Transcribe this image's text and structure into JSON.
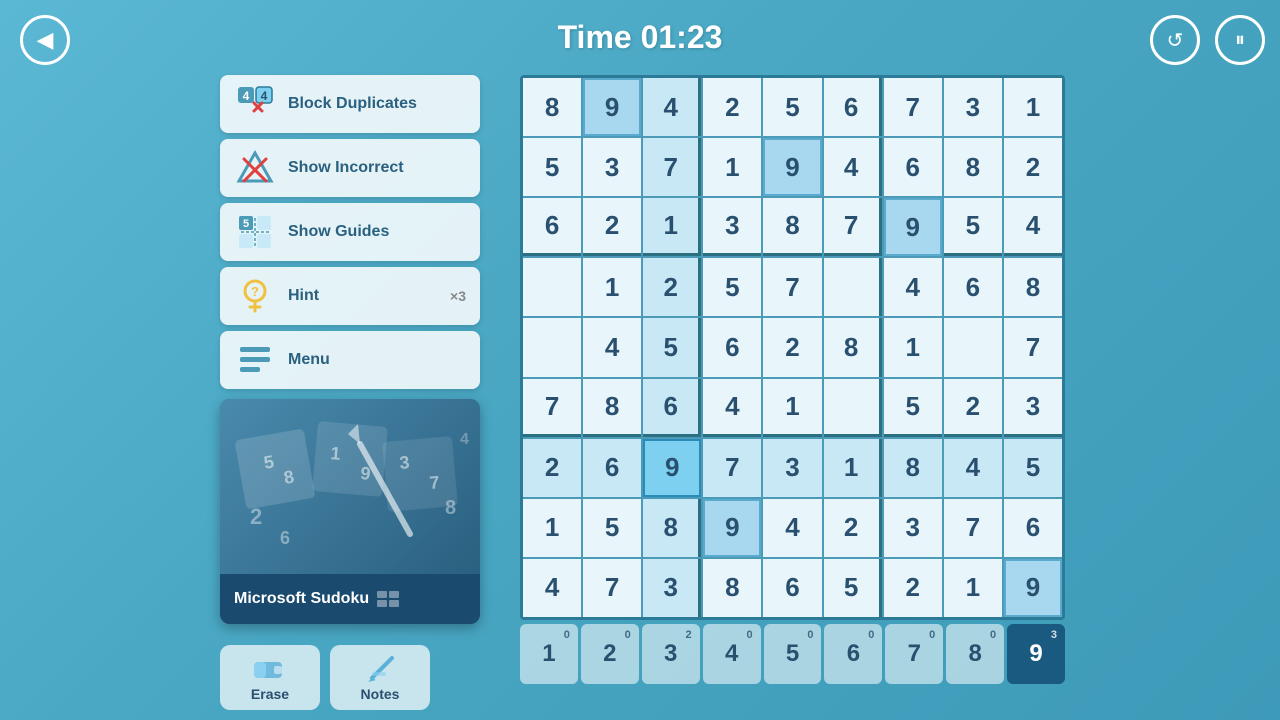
{
  "header": {
    "timer_label": "Time 01:23",
    "back_label": "◀",
    "undo_label": "↺",
    "pause_label": "⏸"
  },
  "menu": {
    "block_duplicates_label": "Block Duplicates",
    "show_incorrect_label": "Show Incorrect",
    "show_guides_label": "Show Guides",
    "hint_label": "Hint",
    "hint_count": "×3",
    "menu_label": "Menu"
  },
  "preview": {
    "title": "Microsoft Sudoku"
  },
  "grid": {
    "cells": [
      [
        8,
        9,
        4,
        2,
        5,
        6,
        7,
        3,
        1
      ],
      [
        5,
        3,
        7,
        1,
        9,
        4,
        6,
        8,
        2
      ],
      [
        6,
        2,
        1,
        3,
        8,
        7,
        9,
        5,
        4
      ],
      [
        0,
        1,
        2,
        5,
        7,
        0,
        4,
        6,
        8
      ],
      [
        0,
        4,
        5,
        6,
        2,
        8,
        1,
        0,
        7
      ],
      [
        7,
        8,
        6,
        4,
        1,
        0,
        5,
        2,
        3
      ],
      [
        2,
        6,
        9,
        7,
        3,
        1,
        8,
        4,
        5
      ],
      [
        1,
        5,
        8,
        9,
        4,
        2,
        3,
        7,
        6
      ],
      [
        4,
        7,
        3,
        8,
        6,
        5,
        2,
        1,
        9
      ]
    ],
    "highlighted_cells": [
      [
        0,
        1
      ],
      [
        1,
        4
      ],
      [
        2,
        6
      ],
      [
        6,
        2
      ],
      [
        7,
        3
      ],
      [
        8,
        8
      ]
    ],
    "selected_cell": [
      6,
      2
    ]
  },
  "numbers": {
    "items": [
      {
        "value": "1",
        "sup": "0"
      },
      {
        "value": "2",
        "sup": "0"
      },
      {
        "value": "3",
        "sup": "2"
      },
      {
        "value": "4",
        "sup": "0"
      },
      {
        "value": "5",
        "sup": "0"
      },
      {
        "value": "6",
        "sup": "0"
      },
      {
        "value": "7",
        "sup": "0"
      },
      {
        "value": "8",
        "sup": "0"
      },
      {
        "value": "9",
        "sup": "3"
      }
    ],
    "active_index": 8
  },
  "tools": {
    "erase_label": "Erase",
    "notes_label": "Notes"
  }
}
